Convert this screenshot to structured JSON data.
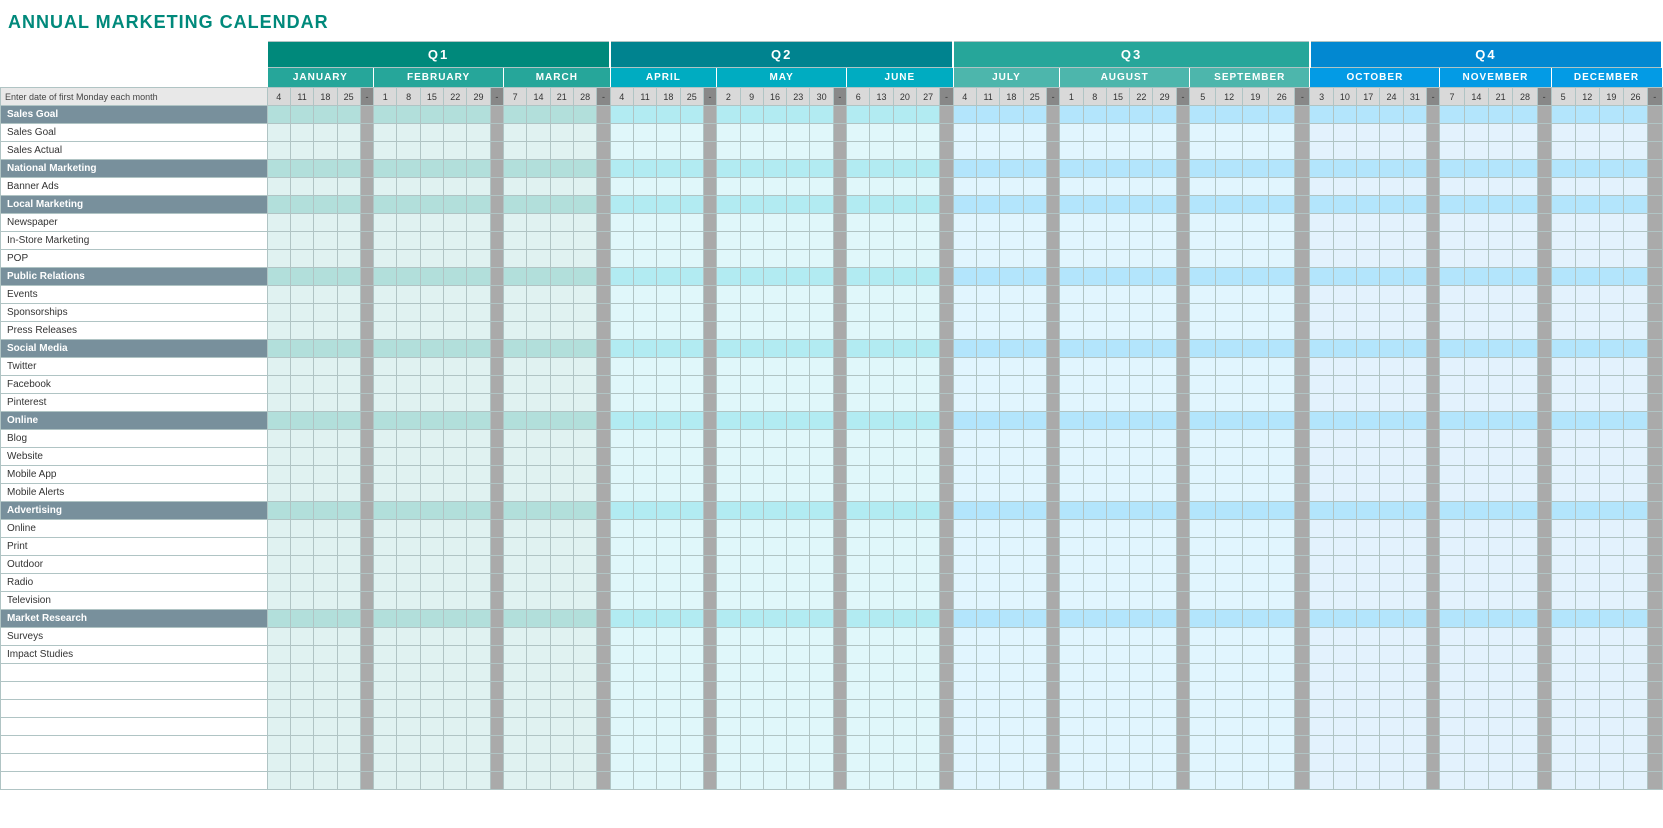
{
  "title": "ANNUAL MARKETING CALENDAR",
  "quarters": [
    {
      "label": "Q1",
      "span": 16
    },
    {
      "label": "Q2",
      "span": 14
    },
    {
      "label": "Q3",
      "span": 16
    },
    {
      "label": "Q4",
      "span": 15
    }
  ],
  "months": [
    {
      "label": "JANUARY",
      "days": [
        "4",
        "11",
        "18",
        "25"
      ],
      "q": 1
    },
    {
      "label": "FEBRUARY",
      "days": [
        "1",
        "8",
        "15",
        "22",
        "29"
      ],
      "q": 1
    },
    {
      "label": "MARCH",
      "days": [
        "7",
        "14",
        "21",
        "28"
      ],
      "q": 1
    },
    {
      "label": "APRIL",
      "days": [
        "4",
        "11",
        "18",
        "25"
      ],
      "q": 2
    },
    {
      "label": "MAY",
      "days": [
        "2",
        "9",
        "16",
        "23",
        "30"
      ],
      "q": 2
    },
    {
      "label": "JUNE",
      "days": [
        "6",
        "13",
        "20",
        "27"
      ],
      "q": 2
    },
    {
      "label": "JULY",
      "days": [
        "4",
        "11",
        "18",
        "25"
      ],
      "q": 3
    },
    {
      "label": "AUGUST",
      "days": [
        "1",
        "8",
        "15",
        "22",
        "29"
      ],
      "q": 3
    },
    {
      "label": "SEPTEMBER",
      "days": [
        "5",
        "12",
        "19",
        "26"
      ],
      "q": 3
    },
    {
      "label": "OCTOBER",
      "days": [
        "3",
        "10",
        "17",
        "24",
        "31"
      ],
      "q": 4
    },
    {
      "label": "NOVEMBER",
      "days": [
        "7",
        "14",
        "21",
        "28"
      ],
      "q": 4
    },
    {
      "label": "DECEMBER",
      "days": [
        "5",
        "12",
        "19",
        "26"
      ],
      "q": 4
    }
  ],
  "firstRowLabel": "Enter date of first Monday each month",
  "categories": [
    {
      "type": "category",
      "label": "Sales Goal"
    },
    {
      "type": "data",
      "label": "Sales Goal"
    },
    {
      "type": "data",
      "label": "Sales Actual"
    },
    {
      "type": "category",
      "label": "National Marketing"
    },
    {
      "type": "data",
      "label": "Banner Ads"
    },
    {
      "type": "category",
      "label": "Local Marketing"
    },
    {
      "type": "data",
      "label": "Newspaper"
    },
    {
      "type": "data",
      "label": "In-Store Marketing"
    },
    {
      "type": "data",
      "label": "POP"
    },
    {
      "type": "category",
      "label": "Public Relations"
    },
    {
      "type": "data",
      "label": "Events"
    },
    {
      "type": "data",
      "label": "Sponsorships"
    },
    {
      "type": "data",
      "label": "Press Releases"
    },
    {
      "type": "category",
      "label": "Social Media"
    },
    {
      "type": "data",
      "label": "Twitter"
    },
    {
      "type": "data",
      "label": "Facebook"
    },
    {
      "type": "data",
      "label": "Pinterest"
    },
    {
      "type": "category",
      "label": "Online"
    },
    {
      "type": "data",
      "label": "Blog"
    },
    {
      "type": "data",
      "label": "Website"
    },
    {
      "type": "data",
      "label": "Mobile App"
    },
    {
      "type": "data",
      "label": "Mobile Alerts"
    },
    {
      "type": "category",
      "label": "Advertising"
    },
    {
      "type": "data",
      "label": "Online"
    },
    {
      "type": "data",
      "label": "Print"
    },
    {
      "type": "data",
      "label": "Outdoor"
    },
    {
      "type": "data",
      "label": "Radio"
    },
    {
      "type": "data",
      "label": "Television"
    },
    {
      "type": "category",
      "label": "Market Research"
    },
    {
      "type": "data",
      "label": "Surveys"
    },
    {
      "type": "data",
      "label": "Impact Studies"
    },
    {
      "type": "data",
      "label": ""
    },
    {
      "type": "data",
      "label": ""
    },
    {
      "type": "data",
      "label": ""
    },
    {
      "type": "data",
      "label": ""
    },
    {
      "type": "data",
      "label": ""
    },
    {
      "type": "data",
      "label": ""
    },
    {
      "type": "data",
      "label": ""
    }
  ]
}
